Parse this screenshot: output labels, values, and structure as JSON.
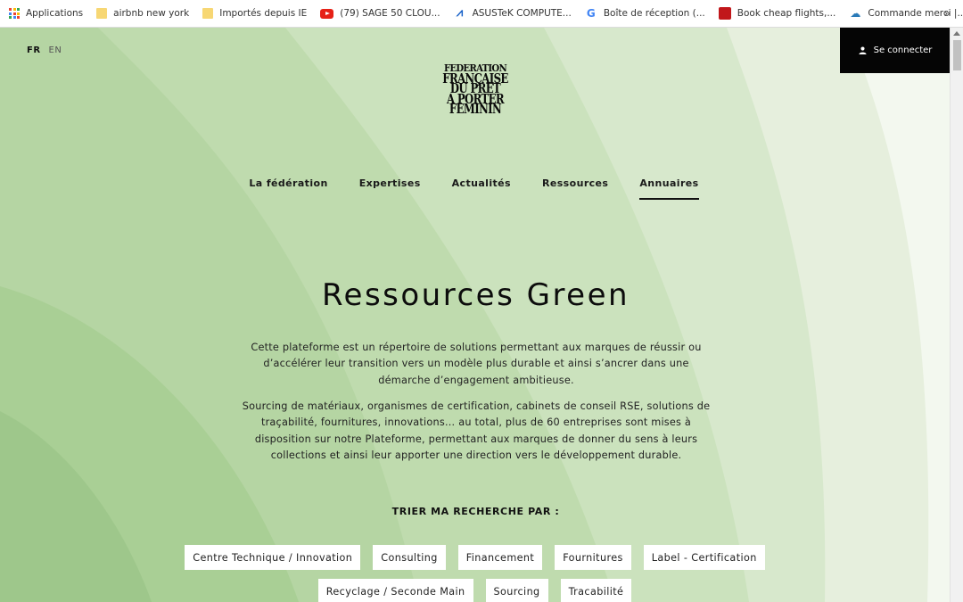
{
  "bookmarks": {
    "items": [
      {
        "label": "Applications",
        "icon": "apps-grid-icon"
      },
      {
        "label": "airbnb new york",
        "icon": "folder-icon"
      },
      {
        "label": "Importés depuis IE",
        "icon": "folder-icon"
      },
      {
        "label": "(79) SAGE 50 CLOU...",
        "icon": "youtube-icon"
      },
      {
        "label": "ASUSTeK COMPUTE...",
        "icon": "asus-icon"
      },
      {
        "label": "Boîte de réception (...",
        "icon": "google-icon"
      },
      {
        "label": "Book cheap flights,...",
        "icon": "book-icon"
      },
      {
        "label": "Commande merci |...",
        "icon": "order-icon"
      }
    ],
    "more": "»"
  },
  "header": {
    "lang_fr": "FR",
    "lang_en": "EN",
    "login_label": "Se connecter",
    "logo_lines": [
      "FEDERATION",
      "FRANÇAISE",
      "DU PRET",
      "A PORTER",
      "FEMININ"
    ]
  },
  "nav": {
    "items": [
      "La fédération",
      "Expertises",
      "Actualités",
      "Ressources",
      "Annuaires"
    ],
    "active": "Annuaires"
  },
  "main": {
    "title": "Ressources Green",
    "paragraph1": "Cette plateforme est un répertoire de solutions permettant aux marques de réussir ou d’accélérer leur transition vers un modèle plus durable et ainsi s’ancrer dans une démarche d’engagement ambitieuse.",
    "paragraph2": "Sourcing de matériaux, organismes de certification, cabinets de conseil RSE, solutions de traçabilité, fournitures, innovations… au total, plus de 60 entreprises sont mises à disposition sur notre Plateforme, permettant aux marques de donner du sens à leurs collections et ainsi leur apporter une direction vers le développement durable.",
    "sort_label": "TRIER MA RECHERCHE PAR :",
    "filters_row1": [
      "Centre Technique / Innovation",
      "Consulting",
      "Financement",
      "Fournitures",
      "Label - Certification"
    ],
    "filters_row2": [
      "Recyclage / Seconde Main",
      "Sourcing",
      "Tracabilité"
    ]
  },
  "colors": {
    "background_light": "#f3f8ef",
    "wave_green_dark": "#9ec78b",
    "accent_black": "#050505"
  }
}
